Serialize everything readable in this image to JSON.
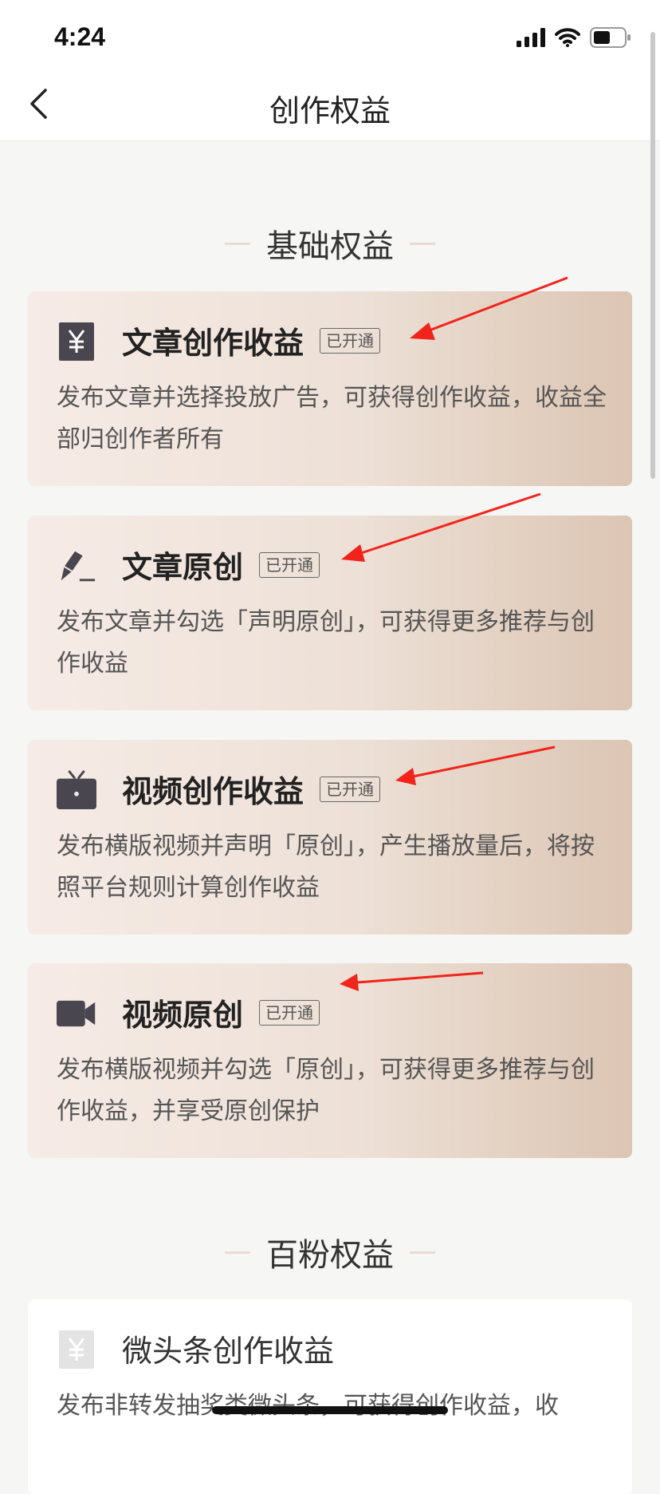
{
  "status_bar": {
    "time": "4:24",
    "icons": [
      "cellular-signal-icon",
      "wifi-icon",
      "battery-icon"
    ]
  },
  "nav": {
    "back_icon": "chevron-left-icon",
    "title": "创作权益"
  },
  "sections": [
    {
      "title": "基础权益",
      "cards": [
        {
          "icon": "yuan-icon",
          "title": "文章创作收益",
          "badge": "已开通",
          "description": "发布文章并选择投放广告，可获得创作收益，收益全部归创作者所有"
        },
        {
          "icon": "pen-icon",
          "title": "文章原创",
          "badge": "已开通",
          "description": "发布文章并勾选「声明原创」，可获得更多推荐与创作收益"
        },
        {
          "icon": "tv-icon",
          "title": "视频创作收益",
          "badge": "已开通",
          "description": "发布横版视频并声明「原创」，产生播放量后，将按照平台规则计算创作收益"
        },
        {
          "icon": "video-camera-icon",
          "title": "视频原创",
          "badge": "已开通",
          "description": "发布横版视频并勾选「原创」，可获得更多推荐与创作收益，并享受原创保护"
        }
      ]
    },
    {
      "title": "百粉权益",
      "cards": [
        {
          "icon": "yuan-icon",
          "title": "微头条创作收益",
          "description": "发布非转发抽奖类微头条，可获得创作收益，收"
        }
      ]
    }
  ],
  "colors": {
    "annotation_arrow": "#f0241b",
    "card_gradient_start": "#f6ebe6",
    "card_gradient_end": "#dcc5b3",
    "icon_dark": "#4a4650"
  }
}
